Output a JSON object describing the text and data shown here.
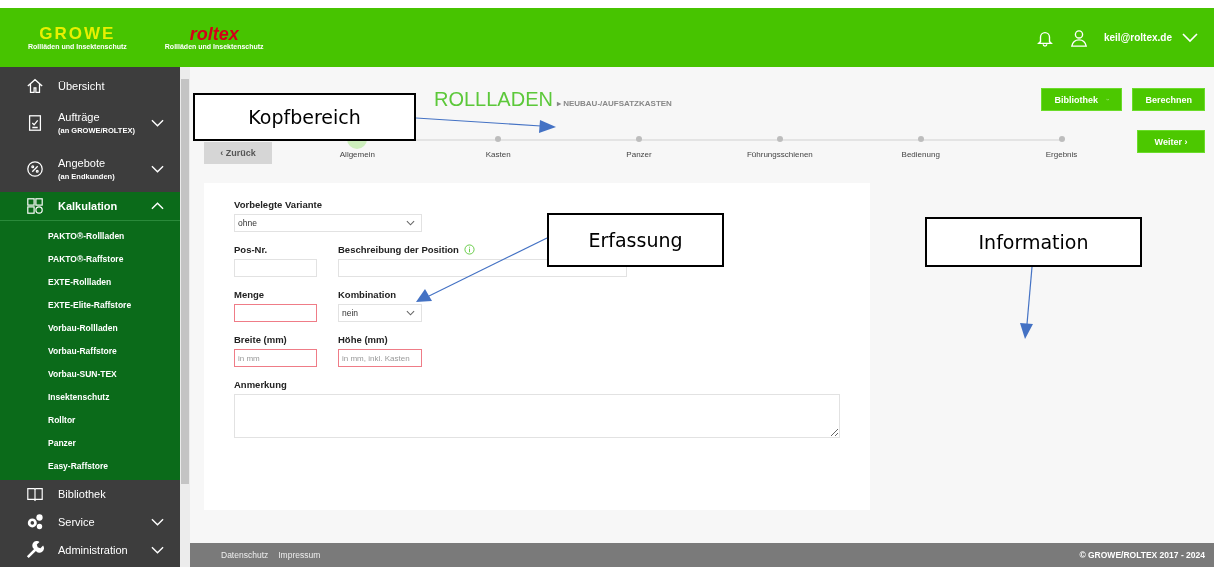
{
  "header": {
    "logos": [
      {
        "name": "GROWE",
        "subtitle": "Rollläden und Insektenschutz"
      },
      {
        "name": "roltex",
        "subtitle": "Rollläden und Insektenschutz"
      }
    ],
    "user": "keil@roltex.de"
  },
  "sidebar": {
    "items": [
      {
        "label": "Übersicht",
        "selected": false
      },
      {
        "label": "Aufträge",
        "sublabel": "(an GROWE/ROLTEX)",
        "selected": false,
        "expanded": false
      },
      {
        "label": "Angebote",
        "sublabel": "(an Endkunden)",
        "selected": false,
        "expanded": false
      },
      {
        "label": "Kalkulation",
        "selected": true,
        "expanded": true,
        "children": [
          {
            "label": "PAKTO®-Rollladen"
          },
          {
            "label": "PAKTO®-Raffstore"
          },
          {
            "label": "EXTE-Rollladen"
          },
          {
            "label": "EXTE-Elite-Raffstore"
          },
          {
            "label": "Vorbau-Rollladen"
          },
          {
            "label": "Vorbau-Raffstore"
          },
          {
            "label": "Vorbau-SUN-TEX"
          },
          {
            "label": "Insektenschutz"
          },
          {
            "label": "Rolltor"
          },
          {
            "label": "Panzer"
          },
          {
            "label": "Easy-Raffstore"
          }
        ]
      },
      {
        "label": "Bibliothek",
        "selected": false
      },
      {
        "label": "Service",
        "selected": false,
        "expanded": false
      },
      {
        "label": "Administration",
        "selected": false,
        "expanded": false
      }
    ]
  },
  "page": {
    "title": "ROLLLADEN",
    "subtitle": "▸ NEUBAU-/AUFSATZKASTEN",
    "back_button": "‹ Zurück",
    "buttons": [
      "Bibliothek",
      "Berechnen"
    ],
    "next_button": "Weiter ›"
  },
  "steps": [
    {
      "label": "Allgemein",
      "selected": true
    },
    {
      "label": "Kasten",
      "selected": false
    },
    {
      "label": "Panzer",
      "selected": false
    },
    {
      "label": "Führungsschienen",
      "selected": false
    },
    {
      "label": "Bedienung",
      "selected": false
    },
    {
      "label": "Ergebnis",
      "selected": false
    }
  ],
  "form": {
    "variant": {
      "label": "Vorbelegte Variante",
      "value": "ohne"
    },
    "pos_nr": {
      "label": "Pos-Nr.",
      "invalid": false
    },
    "description": {
      "label": "Beschreibung der Position",
      "invalid": false
    },
    "quantity": {
      "label": "Menge",
      "invalid": true
    },
    "combination": {
      "label": "Kombination",
      "value": "nein"
    },
    "width": {
      "label": "Breite (mm)",
      "placeholder": "in mm",
      "invalid": true
    },
    "height": {
      "label": "Höhe (mm)",
      "placeholder": "in mm, inkl. Kasten",
      "invalid": true
    },
    "note": {
      "label": "Anmerkung"
    }
  },
  "callouts": [
    {
      "text": "Kopfbereich"
    },
    {
      "text": "Erfassung"
    },
    {
      "text": "Information"
    }
  ],
  "footer": {
    "links": [
      "Datenschutz",
      "Impressum"
    ],
    "copyright": "© GROWE/ROLTEX 2017 - 2024"
  }
}
